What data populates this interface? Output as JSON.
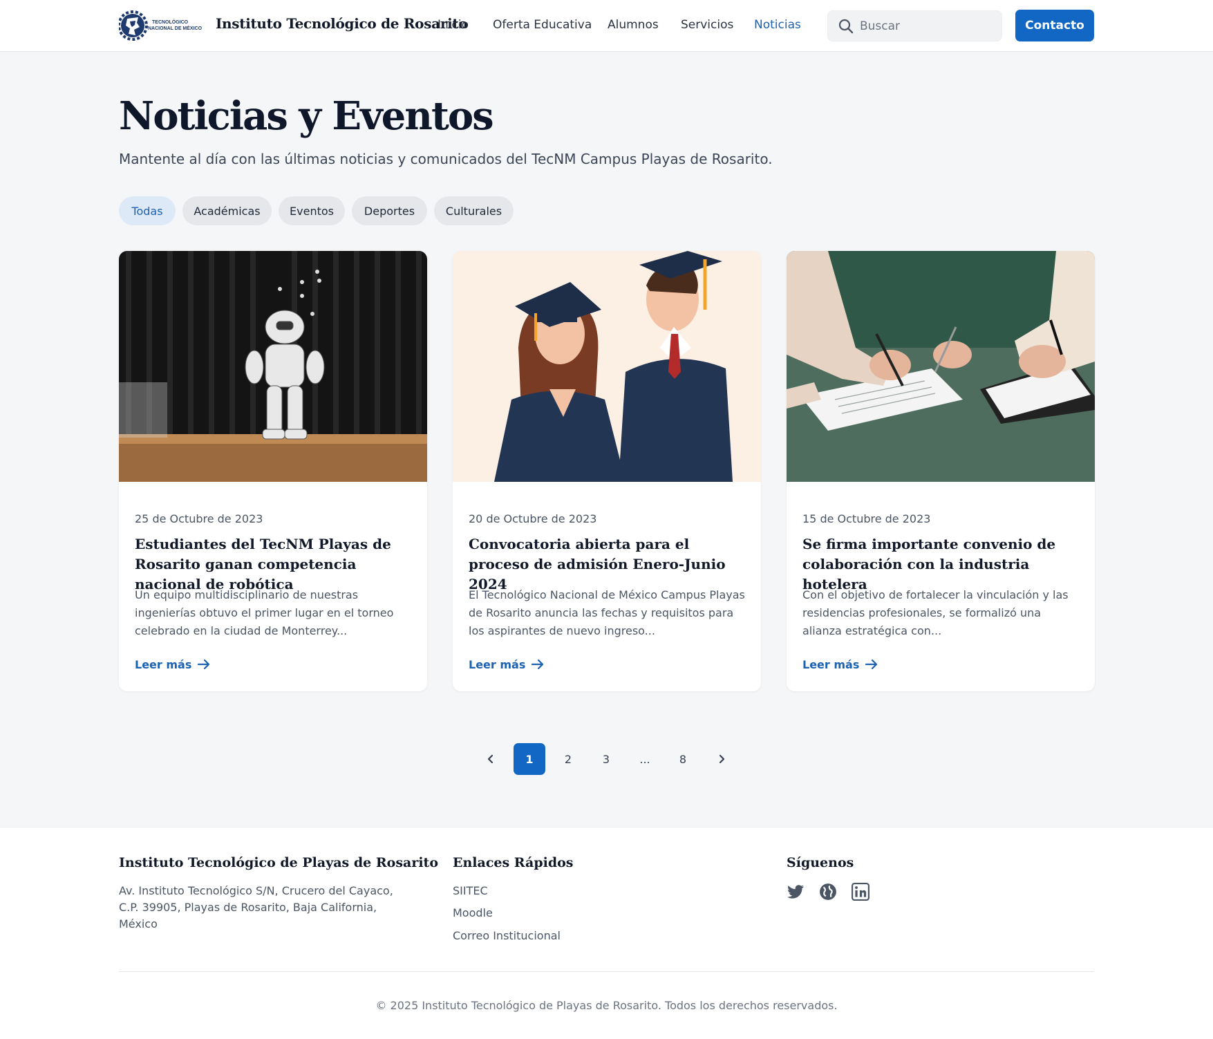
{
  "header": {
    "logo_text": "TECNOLÓGICO NACIONAL DE MÉXICO",
    "brand": "Instituto Tecnológico de Rosarito",
    "nav": [
      "Inicio",
      "Oferta Educativa",
      "Alumnos",
      "Servicios",
      "Noticias"
    ],
    "active_nav": "Noticias",
    "search_placeholder": "Buscar",
    "contact_label": "Contacto"
  },
  "hero": {
    "title": "Noticias y Eventos",
    "subtitle": "Mantente al día con las últimas noticias y comunicados del TecNM Campus Playas de Rosarito."
  },
  "filters": {
    "items": [
      "Todas",
      "Académicas",
      "Eventos",
      "Deportes",
      "Culturales"
    ],
    "active": "Todas"
  },
  "news": [
    {
      "image": "humanoid robot on stage",
      "date": "25 de Octubre de 2023",
      "title": "Estudiantes del TecNM Playas de Rosarito ganan competencia nacional de robótica",
      "excerpt": "Un equipo multidisciplinario de nuestras ingenierías obtuvo el primer lugar en el torneo celebrado en la ciudad de Monterrey...",
      "link": "Leer más"
    },
    {
      "image": "two graduates illustration",
      "date": "20 de Octubre de 2023",
      "title": "Convocatoria abierta para el proceso de admisión Enero-Junio 2024",
      "excerpt": "El Tecnológico Nacional de México Campus Playas de Rosarito anuncia las fechas y requisitos para los aspirantes de nuevo ingreso...",
      "link": "Leer más"
    },
    {
      "image": "hands signing agreement",
      "date": "15 de Octubre de 2023",
      "title": "Se firma importante convenio de colaboración con la industria hotelera",
      "excerpt": "Con el objetivo de fortalecer la vinculación y las residencias profesionales, se formalizó una alianza estratégica con...",
      "link": "Leer más"
    }
  ],
  "pagination": {
    "pages": [
      "1",
      "2",
      "3",
      "...",
      "8"
    ],
    "current": "1"
  },
  "footer": {
    "institution": "Instituto Tecnológico de Playas de Rosarito",
    "address": "Av. Instituto Tecnológico S/N, Crucero del Cayaco, C.P. 39905, Playas de Rosarito, Baja California, México",
    "links_heading": "Enlaces Rápidos",
    "links": [
      "SIITEC",
      "Moodle",
      "Correo Institucional"
    ],
    "social_heading": "Síguenos",
    "social_icons": [
      "twitter-icon",
      "globe-icon",
      "linkedin-icon"
    ],
    "copyright": "© 2025 Instituto Tecnológico de Playas de Rosarito. Todos los derechos reservados."
  },
  "colors": {
    "primary": "#1266c4",
    "link": "#1b62b3",
    "active_chip_bg": "#dde9f7",
    "page_bg": "#f5f6f8"
  }
}
